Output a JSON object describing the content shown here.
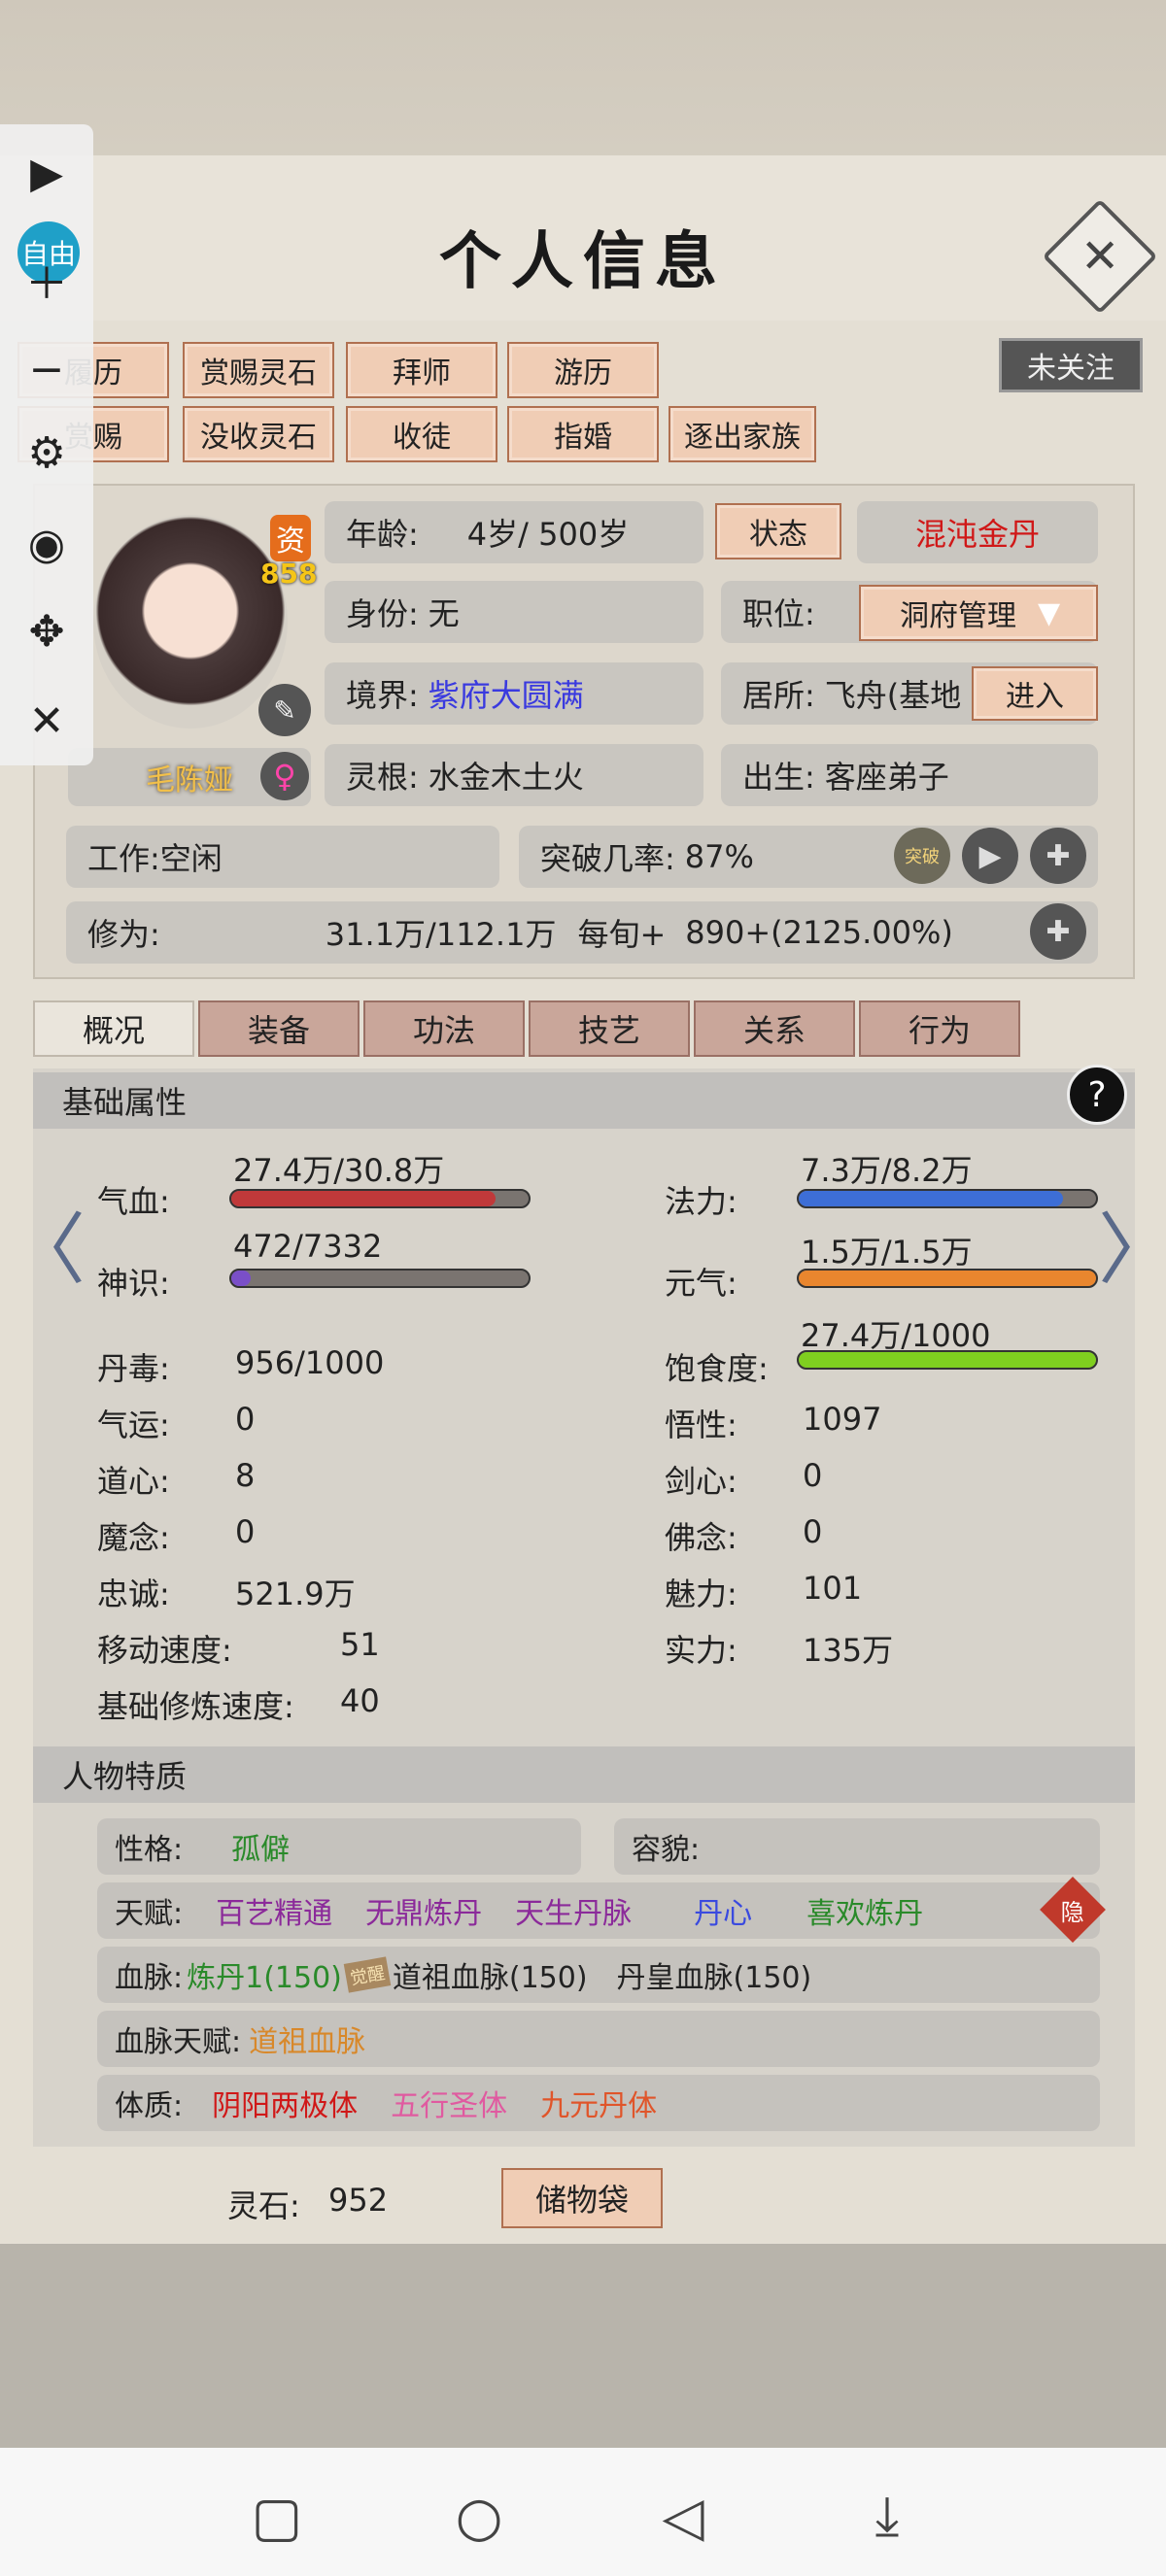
{
  "title": "个人信息",
  "close_label": "✕",
  "follow_label": "未关注",
  "action_buttons_row1": [
    "履历",
    "赏赐灵石",
    "拜师",
    "游历"
  ],
  "action_buttons_row2": [
    "赏赐",
    "没收灵石",
    "收徒",
    "指婚",
    "逐出家族"
  ],
  "avatar": {
    "zi_badge": "资",
    "zi_value": "858",
    "name": "毛陈娅",
    "gender_icon": "♀"
  },
  "info": {
    "age_label": "年龄:",
    "age_value": "4岁/ 500岁",
    "status_button": "状态",
    "realm_tag": "混沌金丹",
    "identity_label": "身份:",
    "identity_value": "无",
    "position_label": "职位:",
    "position_value": "洞府管理",
    "state_label": "境界:",
    "state_value": "紫府大圆满",
    "residence_label": "居所:",
    "residence_value": "飞舟(基地",
    "enter_button": "进入",
    "root_label": "灵根:",
    "root_value": "水金木土火",
    "origin_label": "出生:",
    "origin_value": "客座弟子",
    "work_label": "工作:",
    "work_value": "空闲",
    "breakthrough_label": "突破几率:",
    "breakthrough_value": "87%",
    "breakthrough_icon_text": "突破",
    "cultivation_label": "修为:",
    "cultivation_value": "31.1万/112.1万",
    "per_period_label": "每旬+",
    "per_period_value": "890+(2125.00%)"
  },
  "tabs": [
    "概况",
    "装备",
    "功法",
    "技艺",
    "关系",
    "行为"
  ],
  "active_tab": "概况",
  "basic_section_title": "基础属性",
  "help_icon": "?",
  "bars": {
    "hp": {
      "label": "气血:",
      "value": "27.4万/30.8万",
      "fraction": 0.89,
      "color": "#c0393a"
    },
    "mana": {
      "label": "法力:",
      "value": "7.3万/8.2万",
      "fraction": 0.89,
      "color": "#3d6ed6"
    },
    "sense": {
      "label": "神识:",
      "value": "472/7332",
      "fraction": 0.064,
      "color": "#7a4fc8"
    },
    "vitality": {
      "label": "元气:",
      "value": "1.5万/1.5万",
      "fraction": 1.0,
      "color": "#e9862e"
    },
    "satiety": {
      "label": "饱食度:",
      "value": "27.4万/1000",
      "fraction": 1.0,
      "color": "#7fcf1f"
    }
  },
  "stats_left": [
    {
      "label": "丹毒:",
      "value": "956/1000"
    },
    {
      "label": "气运:",
      "value": "0"
    },
    {
      "label": "道心:",
      "value": "8"
    },
    {
      "label": "魔念:",
      "value": "0"
    },
    {
      "label": "忠诚:",
      "value": "521.9万"
    },
    {
      "label": "移动速度:",
      "value": "51"
    },
    {
      "label": "基础修炼速度:",
      "value": "40"
    }
  ],
  "stats_right": [
    {
      "label": "悟性:",
      "value": "1097"
    },
    {
      "label": "剑心:",
      "value": "0"
    },
    {
      "label": "佛念:",
      "value": "0"
    },
    {
      "label": "魅力:",
      "value": "101"
    },
    {
      "label": "实力:",
      "value": "135万"
    }
  ],
  "traits_section_title": "人物特质",
  "traits": {
    "personality_label": "性格:",
    "personality_value": "孤僻",
    "appearance_label": "容貌:",
    "talent_label": "天赋:",
    "talents": [
      "百艺精通",
      "无鼎炼丹",
      "天生丹脉",
      "丹心",
      "喜欢炼丹"
    ],
    "hide_badge": "隐",
    "bloodline_label": "血脉:",
    "bloodlines": [
      "炼丹1(150)",
      "道祖血脉(150)",
      "丹皇血脉(150)"
    ],
    "bloodline_badge": "觉醒",
    "bloodline_talent_label": "血脉天赋:",
    "bloodline_talent_value": "道祖血脉",
    "physique_label": "体质:",
    "physiques": [
      "阴阳两极体",
      "五行圣体",
      "九元丹体"
    ]
  },
  "spirit_stone_label": "灵石:",
  "spirit_stone_value": "952",
  "storage_button": "储物袋",
  "side_toolbar": {
    "free_label": "自由"
  }
}
